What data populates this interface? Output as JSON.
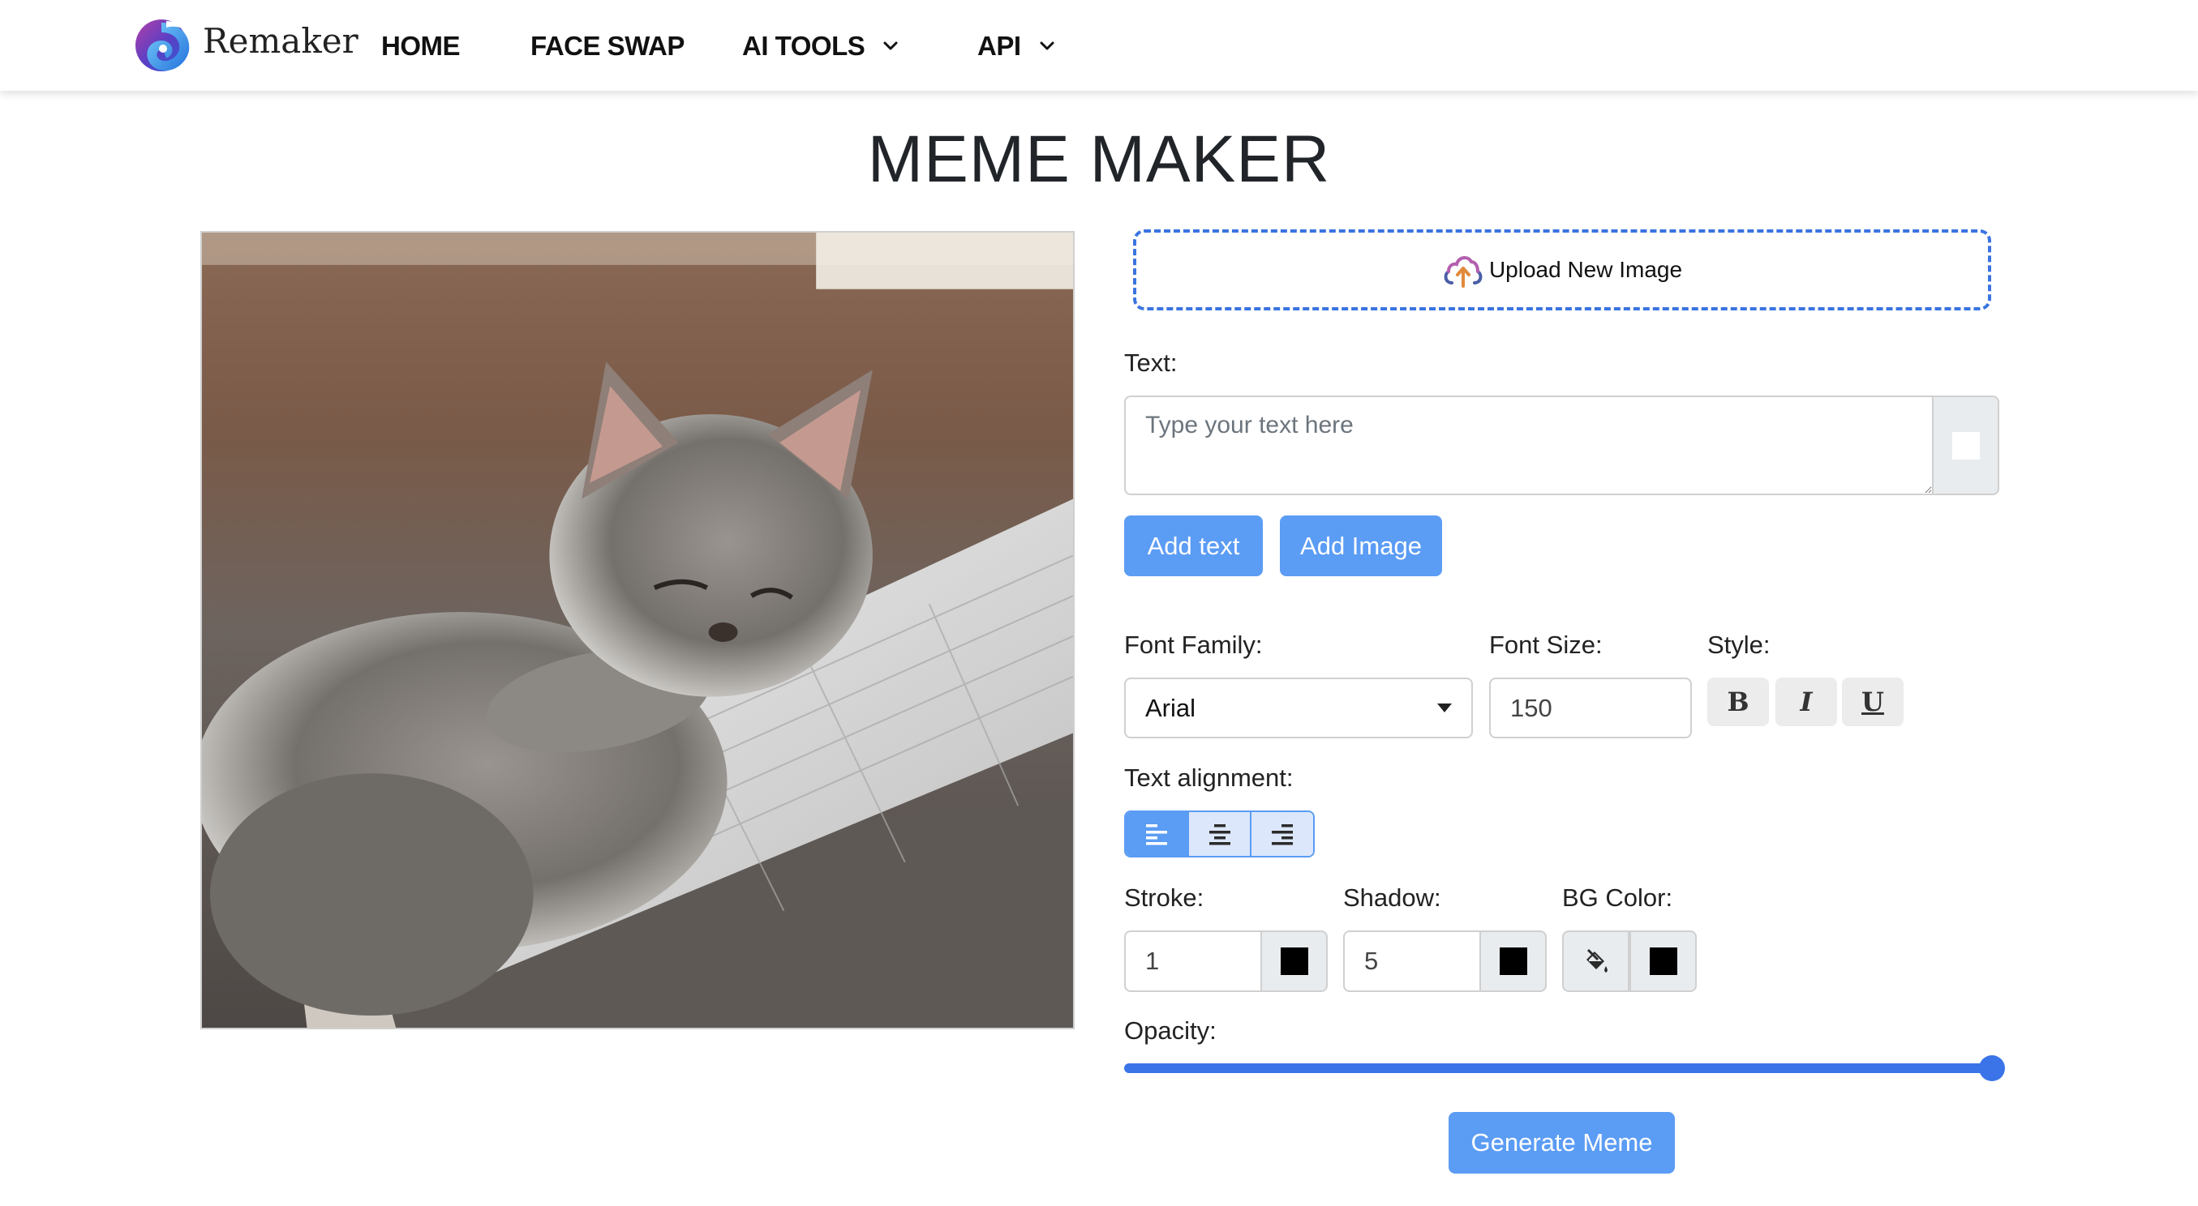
{
  "header": {
    "brand": "Remaker",
    "nav": [
      {
        "label": "HOME",
        "has_dropdown": false
      },
      {
        "label": "FACE SWAP",
        "has_dropdown": false
      },
      {
        "label": "AI TOOLS",
        "has_dropdown": true
      },
      {
        "label": "API",
        "has_dropdown": true
      }
    ]
  },
  "page": {
    "title": "MEME MAKER",
    "image_alt": "Sleepy kitten resting on a keyboard"
  },
  "editor": {
    "upload_label": "Upload New Image",
    "text_label": "Text:",
    "text_placeholder": "Type your text here",
    "text_value": "",
    "text_color": "#ffffff",
    "add_text_label": "Add text",
    "add_image_label": "Add Image",
    "font_family_label": "Font Family:",
    "font_family_value": "Arial",
    "font_size_label": "Font Size:",
    "font_size_value": "150",
    "style_label": "Style:",
    "style_buttons": [
      {
        "name": "bold",
        "glyph": "B"
      },
      {
        "name": "italic",
        "glyph": "I"
      },
      {
        "name": "underline",
        "glyph": "U"
      }
    ],
    "alignment_label": "Text alignment:",
    "alignment_options": [
      "left",
      "center",
      "right"
    ],
    "alignment_selected": "left",
    "stroke_label": "Stroke:",
    "stroke_value": "1",
    "stroke_color": "#000000",
    "shadow_label": "Shadow:",
    "shadow_value": "5",
    "shadow_color": "#000000",
    "bg_color_label": "BG Color:",
    "bg_color": "#000000",
    "opacity_label": "Opacity:",
    "opacity_value": 1.0,
    "generate_label": "Generate Meme"
  },
  "colors": {
    "accent": "#5b9cf4",
    "slider": "#3a74e8",
    "upload_border": "#3a74e0"
  }
}
